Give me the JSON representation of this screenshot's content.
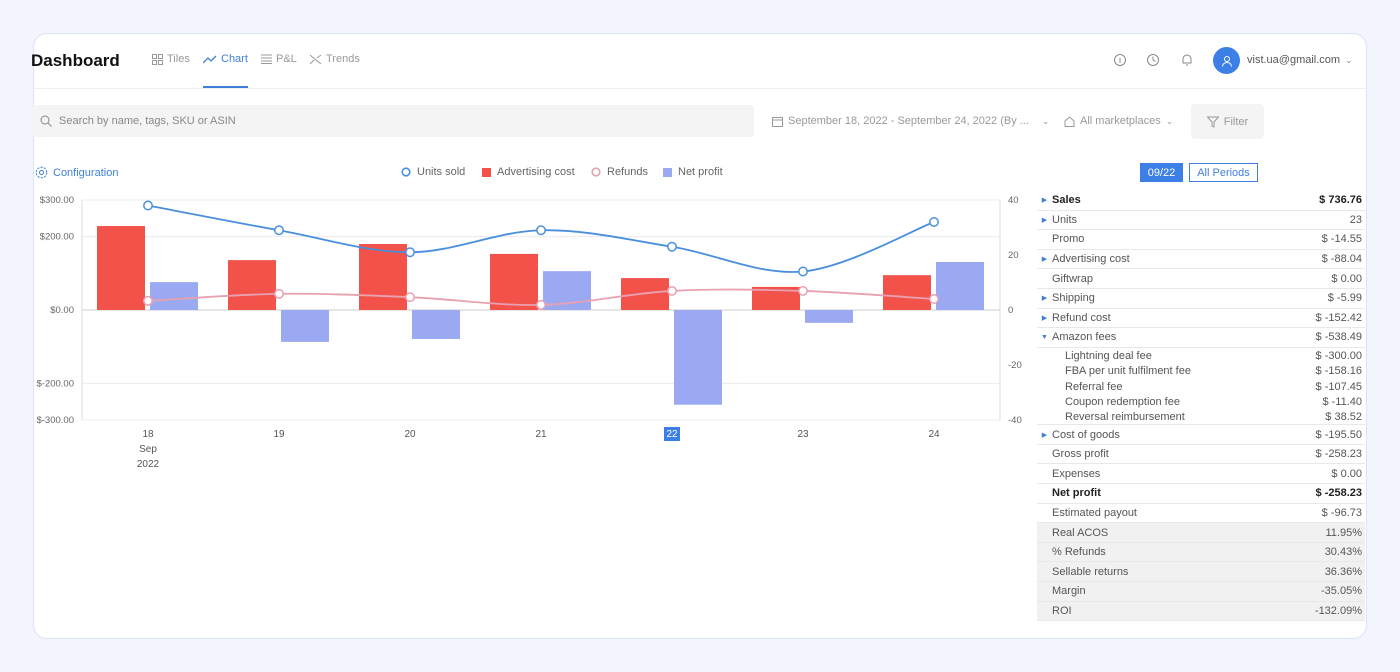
{
  "header": {
    "title": "Dashboard",
    "tabs": [
      {
        "label": "Tiles",
        "icon": "grid-icon"
      },
      {
        "label": "Chart",
        "icon": "trend-icon",
        "active": true
      },
      {
        "label": "P&L",
        "icon": "list-icon"
      },
      {
        "label": "Trends",
        "icon": "shuffle-icon"
      }
    ],
    "user_email": "vist.ua@gmail.com"
  },
  "toolbar": {
    "search_placeholder": "Search by name, tags, SKU or ASIN",
    "date_range": "September 18, 2022 - September 24, 2022 (By ...",
    "marketplace": "All marketplaces",
    "filter_label": "Filter"
  },
  "config_label": "Configuration",
  "period_buttons": {
    "current": "09/22",
    "all": "All Periods"
  },
  "colors": {
    "accent": "#3f7fd9",
    "units": "#4a8fdc",
    "adv": "#f2524a",
    "refunds": "#e8a1b1",
    "net": "#9aa9f2"
  },
  "chart_data": {
    "type": "bar",
    "categories": [
      "18",
      "19",
      "20",
      "21",
      "22",
      "23",
      "24"
    ],
    "x_sublabels": [
      "Sep",
      "2022"
    ],
    "highlighted_category": "22",
    "left_axis": {
      "ticks": [
        "$300.00",
        "$200.00",
        "$0.00",
        "$-200.00",
        "$-300.00"
      ],
      "tick_values": [
        300,
        200,
        0,
        -200,
        -300
      ],
      "range": [
        -300,
        300
      ]
    },
    "right_axis": {
      "ticks": [
        "40",
        "20",
        "0",
        "-20",
        "-40"
      ],
      "tick_values": [
        40,
        20,
        0,
        -20,
        -40
      ],
      "range": [
        -40,
        40
      ]
    },
    "legend_position": "top",
    "series": [
      {
        "name": "Units sold",
        "type": "line",
        "axis": "right",
        "values": [
          38,
          29,
          21,
          29,
          23,
          14,
          32
        ]
      },
      {
        "name": "Advertising cost",
        "type": "bar",
        "axis": "left",
        "values": [
          229,
          136,
          180,
          153,
          87,
          63,
          95
        ]
      },
      {
        "name": "Refunds",
        "type": "line",
        "axis": "left",
        "values": [
          25,
          44,
          35,
          14,
          52,
          52,
          30
        ]
      },
      {
        "name": "Net profit",
        "type": "bar",
        "axis": "left",
        "values": [
          76,
          -87,
          -79,
          106,
          -258.23,
          -35,
          131
        ]
      }
    ]
  },
  "summary": [
    {
      "label": "Sales",
      "value": "$ 736.76",
      "arrow": true,
      "bold": true
    },
    {
      "label": "Units",
      "value": "23",
      "arrow": true
    },
    {
      "label": "Promo",
      "value": "$ -14.55"
    },
    {
      "label": "Advertising cost",
      "value": "$ -88.04",
      "arrow": true
    },
    {
      "label": "Giftwrap",
      "value": "$ 0.00"
    },
    {
      "label": "Shipping",
      "value": "$ -5.99",
      "arrow": true
    },
    {
      "label": "Refund cost",
      "value": "$ -152.42",
      "arrow": true
    },
    {
      "label": "Amazon fees",
      "value": "$ -538.49",
      "arrow": true,
      "expanded": true
    },
    {
      "label": "Lightning deal fee",
      "value": "$ -300.00",
      "sub": true
    },
    {
      "label": "FBA per unit fulfilment fee",
      "value": "$ -158.16",
      "sub": true
    },
    {
      "label": "Referral fee",
      "value": "$ -107.45",
      "sub": true
    },
    {
      "label": "Coupon redemption fee",
      "value": "$ -11.40",
      "sub": true
    },
    {
      "label": "Reversal reimbursement",
      "value": "$ 38.52",
      "sub": true,
      "last": true
    },
    {
      "label": "Cost of goods",
      "value": "$ -195.50",
      "arrow": true
    },
    {
      "label": "Gross profit",
      "value": "$ -258.23"
    },
    {
      "label": "Expenses",
      "value": "$ 0.00"
    },
    {
      "label": "Net profit",
      "value": "$ -258.23",
      "bold": true
    },
    {
      "label": "Estimated payout",
      "value": "$ -96.73"
    },
    {
      "label": "Real ACOS",
      "value": "11.95%",
      "shade": true
    },
    {
      "label": "% Refunds",
      "value": "30.43%",
      "shade": true
    },
    {
      "label": "Sellable returns",
      "value": "36.36%",
      "shade": true
    },
    {
      "label": "Margin",
      "value": "-35.05%",
      "shade": true
    },
    {
      "label": "ROI",
      "value": "-132.09%",
      "shade": true
    }
  ]
}
